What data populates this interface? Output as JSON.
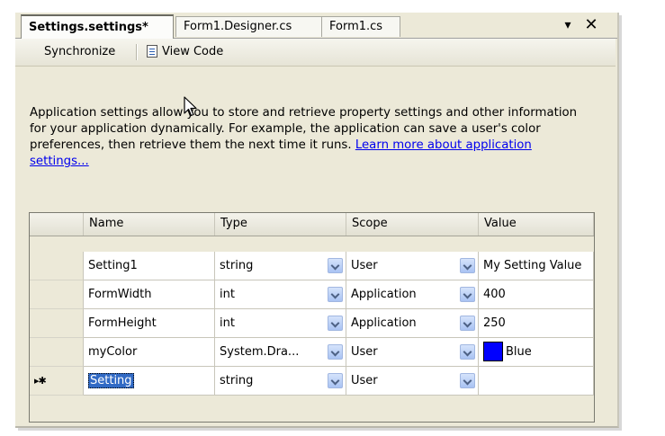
{
  "tabs": [
    {
      "label": "Settings.settings*",
      "active": true
    },
    {
      "label": "Form1.Designer.cs",
      "active": false
    },
    {
      "label": "Form1.cs",
      "active": false
    }
  ],
  "window_controls": {
    "pin": "▾",
    "close": "✕"
  },
  "toolbar": {
    "synchronize": "Synchronize",
    "view_code": "View Code"
  },
  "description": {
    "text": "Application settings allow you to store and retrieve property settings and other information for your application dynamically. For example, the application can save a user's color preferences, then retrieve them the next time it runs. ",
    "link": "Learn more about application settings..."
  },
  "grid": {
    "columns": [
      "Name",
      "Type",
      "Scope",
      "Value"
    ],
    "rows": [
      {
        "name": "Setting1",
        "type": "string",
        "scope": "User",
        "value": "My Setting Value"
      },
      {
        "name": "FormWidth",
        "type": "int",
        "scope": "Application",
        "value": "400"
      },
      {
        "name": "FormHeight",
        "type": "int",
        "scope": "Application",
        "value": "250"
      },
      {
        "name": "myColor",
        "type": "System.Dra...",
        "scope": "User",
        "value": "Blue"
      }
    ],
    "new_row": {
      "marker": "▸✱",
      "name": "Setting",
      "type": "string",
      "scope": "User",
      "value": ""
    },
    "color_swatch": "#0000ff"
  },
  "colors": {
    "panel_bg": "#ece9d8",
    "link": "#0000ee",
    "selection": "#316ac5"
  }
}
